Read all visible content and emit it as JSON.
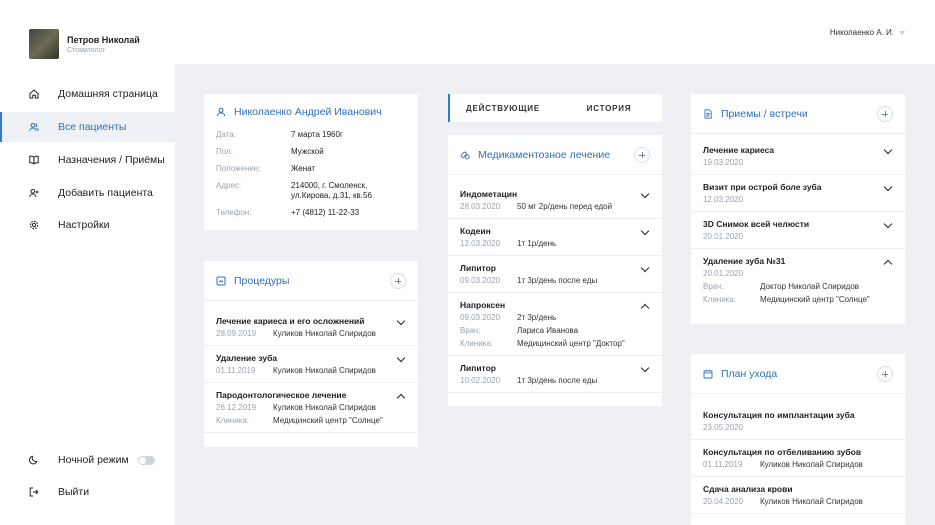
{
  "profile": {
    "name": "Петров Николай",
    "role": "Стоматолог"
  },
  "user_menu": {
    "label": "Николаенко А. И."
  },
  "sidebar": {
    "items": [
      {
        "label": "Домашняя страница",
        "icon": "home-icon"
      },
      {
        "label": "Все пациенты",
        "icon": "users-icon",
        "active": true
      },
      {
        "label": "Назначения / Приёмы",
        "icon": "book-icon"
      },
      {
        "label": "Добавить пациента",
        "icon": "add-user-icon"
      },
      {
        "label": "Настройки",
        "icon": "gear-icon"
      }
    ],
    "night_mode": "Ночной режим",
    "logout": "Выйти"
  },
  "patient": {
    "name": "Николаенко Андрей Иванович",
    "fields": [
      {
        "k": "Дата:",
        "v": "7 марта 1960г"
      },
      {
        "k": "Пол:",
        "v": "Мужской"
      },
      {
        "k": "Положение:",
        "v": "Женат"
      },
      {
        "k": "Адрес:",
        "v": "214000, г. Смоленск,",
        "v2": "ул.Кирова, д.31, кв.56"
      },
      {
        "k": "Телефон:",
        "v": "+7 (4812) 11-22-33"
      }
    ]
  },
  "procedures": {
    "title": "Процедуры",
    "items": [
      {
        "title": "Лечение кариеса и его осложнений",
        "date": "28.09.2019",
        "doctor": "Куликов Николай Спиридов",
        "expanded": false
      },
      {
        "title": "Удаление зуба",
        "date": "01.11.2019",
        "doctor": "Куликов Николай Спиридов",
        "expanded": false
      },
      {
        "title": "Пародонтологическое лечение",
        "date": "26.12.2019",
        "doctor": "Куликов Николай Спиридов",
        "clinic_label": "Клиника:",
        "clinic": "Медицинский центр \"Солнце\"",
        "expanded": true
      }
    ]
  },
  "tabs": {
    "active": "ДЕЙСТВУЮЩИЕ",
    "inactive": "ИСТОРИЯ"
  },
  "medication": {
    "title": "Медикаментозное лечение",
    "items": [
      {
        "title": "Индометацин",
        "date": "28.03.2020",
        "dose": "50 мг 2р/день перед едой",
        "expanded": false
      },
      {
        "title": "Кодеин",
        "date": "12.03.2020",
        "dose": "1т 1р/день",
        "expanded": false
      },
      {
        "title": "Липитор",
        "date": "09.03.2020",
        "dose": "1т 3р/день после еды",
        "expanded": false
      },
      {
        "title": "Напроксен",
        "date": "09.03.2020",
        "dose": "2т 3р/день",
        "doctor_label": "Врач:",
        "doctor": "Лариса Иванова",
        "clinic_label": "Клиника:",
        "clinic": "Медицинский центр \"Доктор\"",
        "expanded": true
      },
      {
        "title": "Липитор",
        "date": "10.02.2020",
        "dose": "1т 3р/день после еды",
        "expanded": false
      }
    ]
  },
  "appointments": {
    "title": "Приемы / встречи",
    "items": [
      {
        "title": "Лечение кариеса",
        "date": "19.03.2020",
        "expanded": false
      },
      {
        "title": "Визит при острой боле зуба",
        "date": "12.03.2020",
        "expanded": false
      },
      {
        "title": "3D Снимок всей челюсти",
        "date": "20.01.2020",
        "expanded": false
      },
      {
        "title": "Удаление зуба №31",
        "date": "20.01.2020",
        "doctor_label": "Врач:",
        "doctor": "Доктор Николай Спиридов",
        "clinic_label": "Клиника:",
        "clinic": "Медицинский центр \"Солнце\"",
        "expanded": true
      }
    ]
  },
  "care_plan": {
    "title": "План ухода",
    "items": [
      {
        "title": "Консультация по имплантации зуба",
        "date": "23.05.2020"
      },
      {
        "title": "Консультация по отбеливанию зубов",
        "date": "01.11.2019",
        "doctor": "Куликов Николай Спиридов"
      },
      {
        "title": "Сдача анализа крови",
        "date": "20.04.2020",
        "doctor": "Куликов Николай Спиридов"
      }
    ]
  }
}
